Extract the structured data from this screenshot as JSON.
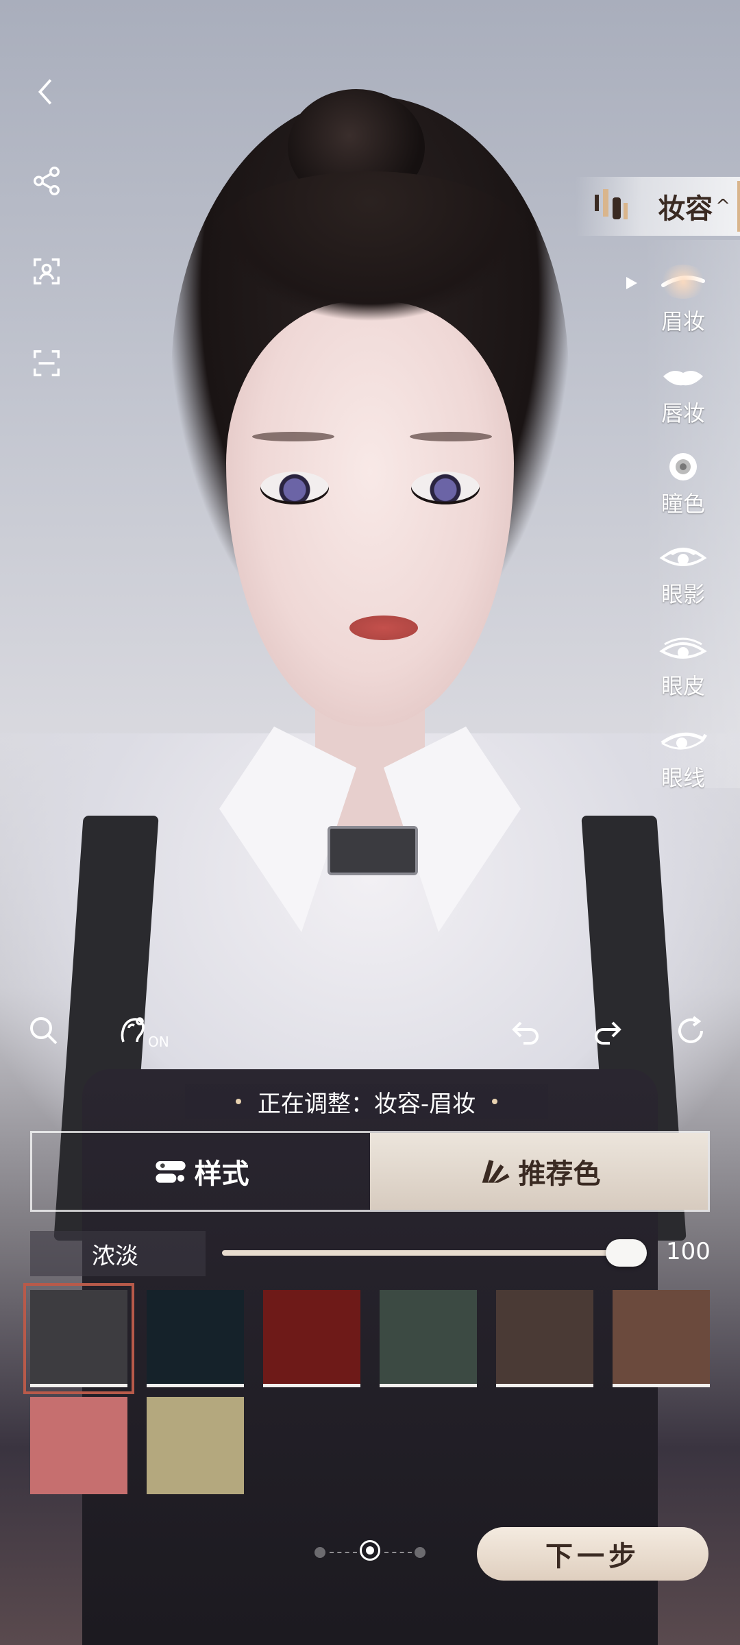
{
  "top_icons": [
    "back-icon",
    "share-icon",
    "face-scan-icon",
    "fullscreen-icon"
  ],
  "makeup_panel": {
    "title": "妆容",
    "items": [
      {
        "label": "眉妆",
        "icon": "eyebrow-icon"
      },
      {
        "label": "唇妆",
        "icon": "lips-icon"
      },
      {
        "label": "瞳色",
        "icon": "pupil-icon"
      },
      {
        "label": "眼影",
        "icon": "eyeshadow-icon"
      },
      {
        "label": "眼皮",
        "icon": "eyelid-icon"
      },
      {
        "label": "眼线",
        "icon": "eyeliner-icon"
      }
    ],
    "active_index": 0
  },
  "toolbar": {
    "on_label": "ON"
  },
  "status": {
    "text": "正在调整：妆容-眉妆"
  },
  "tabs": [
    {
      "label": "样式",
      "icon": "style-icon"
    },
    {
      "label": "推荐色",
      "icon": "palette-icon"
    }
  ],
  "intensity": {
    "label": "浓淡",
    "value": "100",
    "level": 1.0
  },
  "swatches": [
    {
      "color": "#3d3c40",
      "selected": true
    },
    {
      "color": "#15222a",
      "selected": false
    },
    {
      "color": "#6e1a18",
      "selected": false
    },
    {
      "color": "#3c4a43",
      "selected": false
    },
    {
      "color": "#4a3a35",
      "selected": false
    },
    {
      "color": "#6b4a3d",
      "selected": false
    },
    {
      "color": "#c66f6f",
      "selected": false
    },
    {
      "color": "#b4a87e",
      "selected": false
    }
  ],
  "pager": {
    "pages": 3,
    "current": 1
  },
  "next_button": "下一步"
}
